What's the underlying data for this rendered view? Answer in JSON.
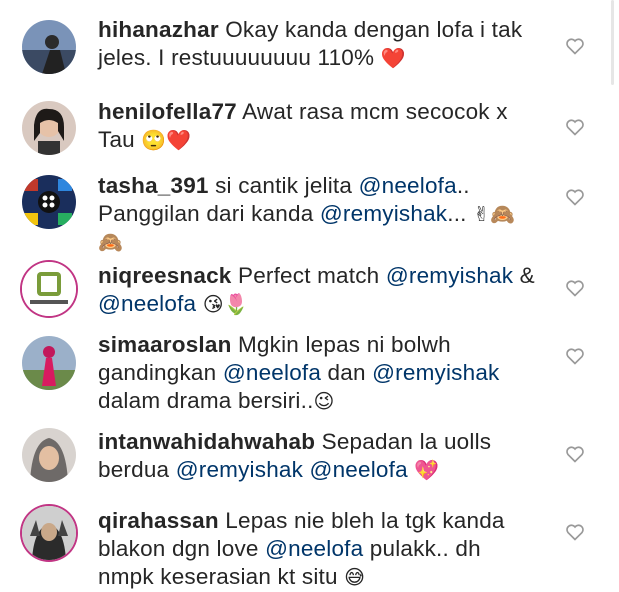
{
  "comments": [
    {
      "username": "hihanazhar",
      "text_before": "Okay kanda dengan lofa i tak jeles. I restuuuuuuuu 110% ",
      "emoji": "❤️"
    },
    {
      "username": "henilofella77",
      "text_before": "Awat rasa mcm secocok x Tau ",
      "emoji": "🙄❤️"
    },
    {
      "username": "tasha_391",
      "text_before": "si cantik jelita ",
      "mention1": "@neelofa",
      "text_mid": ".. Panggilan dari kanda ",
      "mention2": "@remyishak",
      "text_after": "...",
      "emoji": "✌🙈🙈"
    },
    {
      "username": "niqreesnack",
      "text_before": "Perfect match ",
      "mention1": "@remyishak",
      "text_mid": " & ",
      "mention2": "@neelofa",
      "text_after": " ",
      "emoji": "😘🌷"
    },
    {
      "username": "simaaroslan",
      "text_before": "Mgkin lepas ni bolwh gandingkan ",
      "mention1": "@neelofa",
      "text_mid": " dan ",
      "mention2": "@remyishak",
      "text_after": " dalam drama bersiri..",
      "emoji": "😉"
    },
    {
      "username": "intanwahidahwahab",
      "text_before": "Sepadan la uolls berdua ",
      "mention1": "@remyishak",
      "text_mid": " ",
      "mention2": "@neelofa",
      "text_after": " ",
      "emoji": "💖"
    },
    {
      "username": "qirahassan",
      "text_before": "Lepas nie bleh la tgk kanda blakon dgn love ",
      "mention1": "@neelofa",
      "text_mid": " pulakk.. dh nmpk keserasian kt situ ",
      "emoji": "😅"
    }
  ],
  "like_icon": "heart-outline-icon",
  "colors": {
    "text": "#262626",
    "mention": "#003569",
    "icon": "#999999",
    "story_ring": "#c13584"
  }
}
